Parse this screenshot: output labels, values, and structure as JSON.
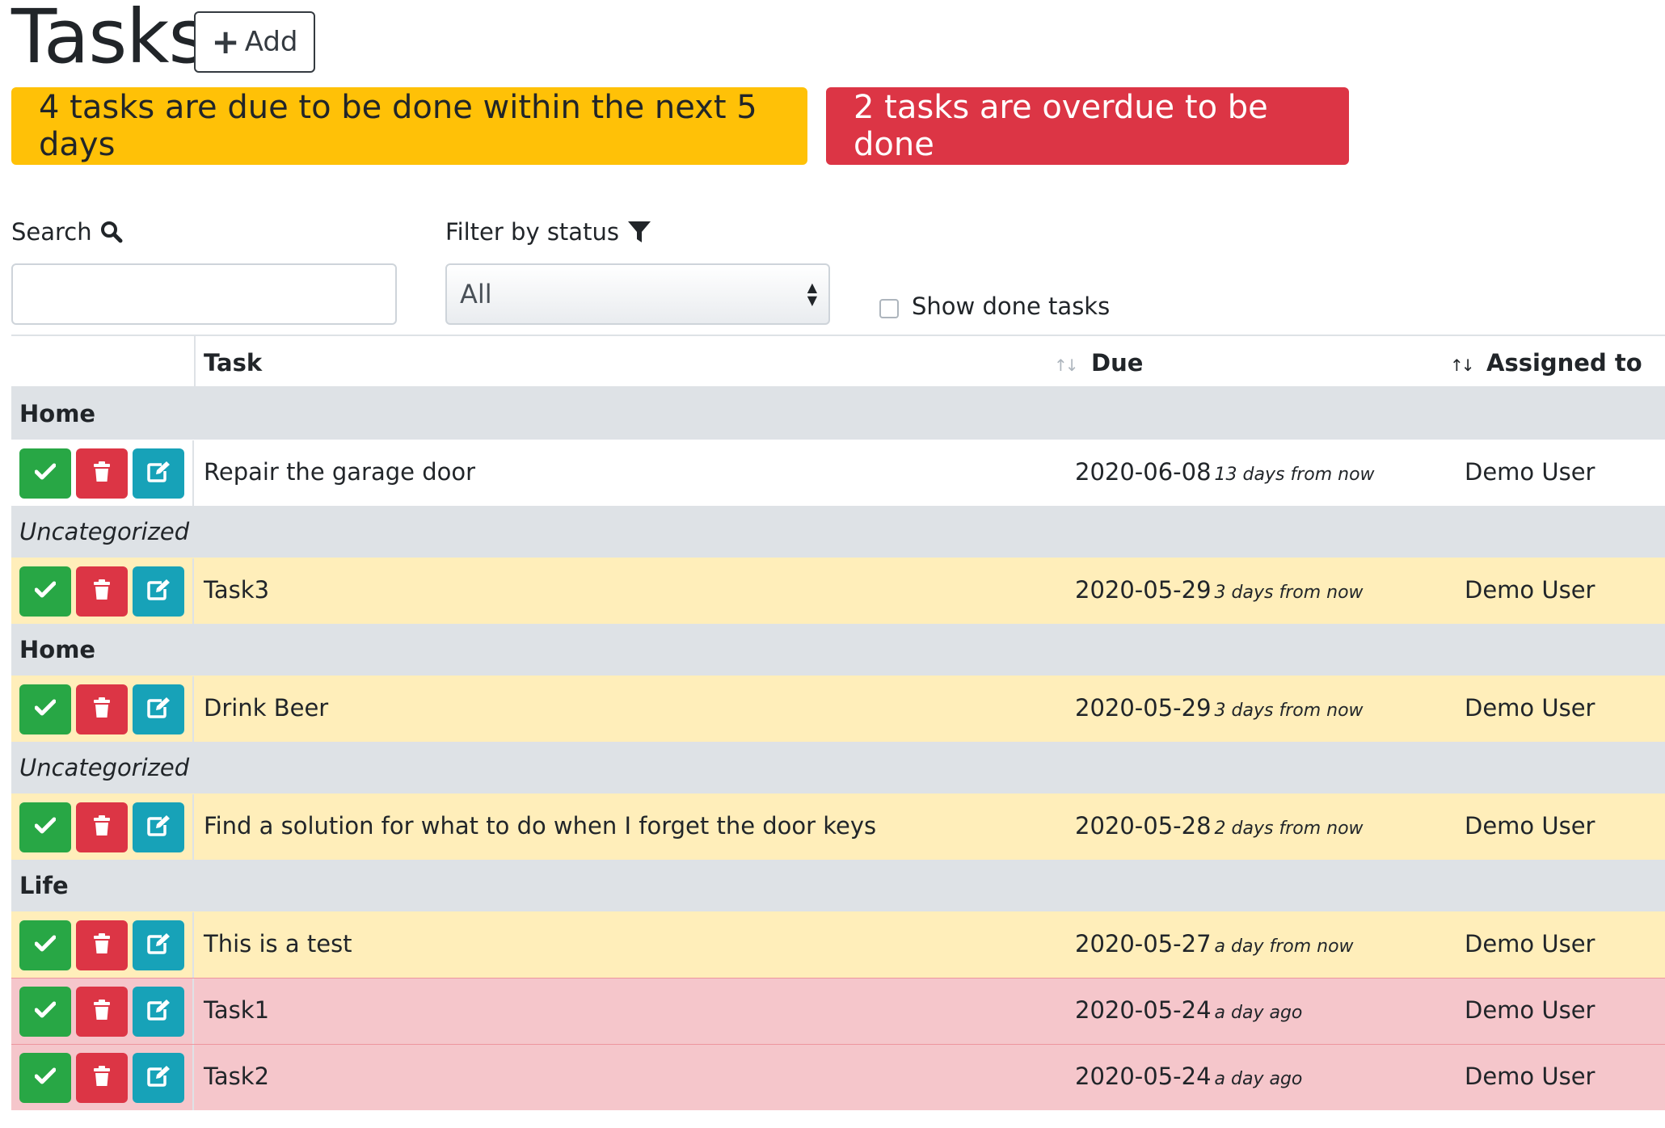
{
  "header": {
    "title": "Tasks",
    "add_label": "Add"
  },
  "alerts": {
    "due_soon": "4 tasks are due to be done within the next 5 days",
    "overdue": "2 tasks are overdue to be done"
  },
  "filters": {
    "search_label": "Search",
    "search_value": "",
    "status_label": "Filter by status",
    "status_selected": "All",
    "show_done_label": "Show done tasks",
    "show_done_checked": false
  },
  "table": {
    "columns": [
      "Task",
      "Due",
      "Assigned to"
    ],
    "groups": [
      {
        "label": "Home",
        "style": "bold",
        "tasks": [
          {
            "name": "Repair the garage door",
            "due": "2020-06-08",
            "relative": "13 days from now",
            "assigned": "Demo User",
            "status": "normal"
          }
        ]
      },
      {
        "label": "Uncategorized",
        "style": "italic",
        "tasks": [
          {
            "name": "Task3",
            "due": "2020-05-29",
            "relative": "3 days from now",
            "assigned": "Demo User",
            "status": "warning"
          }
        ]
      },
      {
        "label": "Home",
        "style": "bold",
        "tasks": [
          {
            "name": "Drink Beer",
            "due": "2020-05-29",
            "relative": "3 days from now",
            "assigned": "Demo User",
            "status": "warning"
          }
        ]
      },
      {
        "label": "Uncategorized",
        "style": "italic",
        "tasks": [
          {
            "name": "Find a solution for what to do when I forget the door keys",
            "due": "2020-05-28",
            "relative": "2 days from now",
            "assigned": "Demo User",
            "status": "warning"
          }
        ]
      },
      {
        "label": "Life",
        "style": "bold",
        "tasks": [
          {
            "name": "This is a test",
            "due": "2020-05-27",
            "relative": "a day from now",
            "assigned": "Demo User",
            "status": "warning"
          },
          {
            "name": "Task1",
            "due": "2020-05-24",
            "relative": "a day ago",
            "assigned": "Demo User",
            "status": "danger"
          },
          {
            "name": "Task2",
            "due": "2020-05-24",
            "relative": "a day ago",
            "assigned": "Demo User",
            "status": "danger"
          }
        ]
      }
    ]
  },
  "colors": {
    "warning": "#ffc107",
    "danger": "#dc3545",
    "success": "#28a745",
    "info": "#17a2b8",
    "row_warning": "#ffeeba",
    "row_danger": "#f5c6cb",
    "group_bg": "#dee2e6"
  },
  "icons": {
    "add": "plus-icon",
    "search": "search-icon",
    "filter": "filter-icon",
    "done": "check-icon",
    "delete": "trash-icon",
    "edit": "edit-icon",
    "sort": "sort-icon"
  }
}
